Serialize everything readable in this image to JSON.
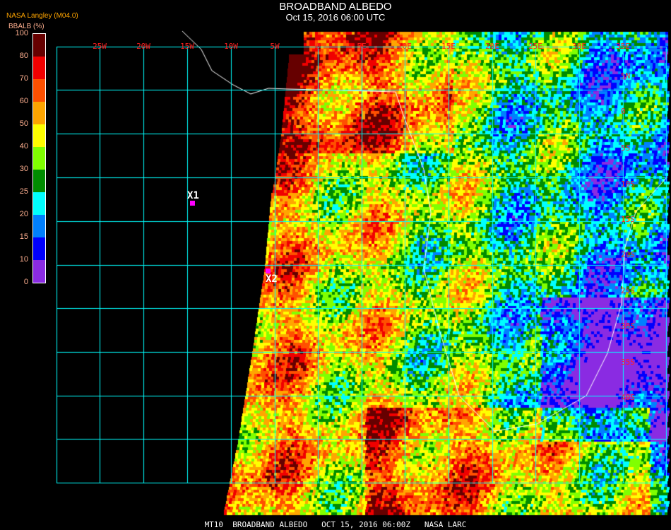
{
  "header": {
    "title": "BROADBAND ALBEDO",
    "datetime": "Oct 15, 2016 06:00 UTC"
  },
  "source_label": "NASA Langley (M04.0)",
  "legend": {
    "unit_label": "BBALB (%)",
    "ticks": [
      "100",
      "80",
      "70",
      "60",
      "50",
      "40",
      "30",
      "25",
      "20",
      "15",
      "10",
      "0"
    ],
    "colors": [
      "#660000",
      "#f00000",
      "#ff5000",
      "#ffa500",
      "#ffff00",
      "#80ff00",
      "#008c00",
      "#00ffff",
      "#0080ff",
      "#0000ff",
      "#8a2be2"
    ]
  },
  "grid": {
    "longitudes": [
      "25W",
      "20W",
      "15W",
      "10W",
      "5W",
      "0",
      "5E",
      "10E",
      "15E",
      "20E",
      "25E",
      "30E",
      "35E"
    ],
    "latitudes": [
      "5N",
      "0",
      "5S",
      "10S",
      "15S",
      "20S",
      "25S",
      "30S",
      "35S",
      "40S"
    ],
    "line_color": "#00ffff"
  },
  "markers": [
    {
      "label": "X1"
    },
    {
      "label": "X2"
    }
  ],
  "footer": "MT10  BROADBAND ALBEDO   OCT 15, 2016 06:00Z   NASA LARC"
}
